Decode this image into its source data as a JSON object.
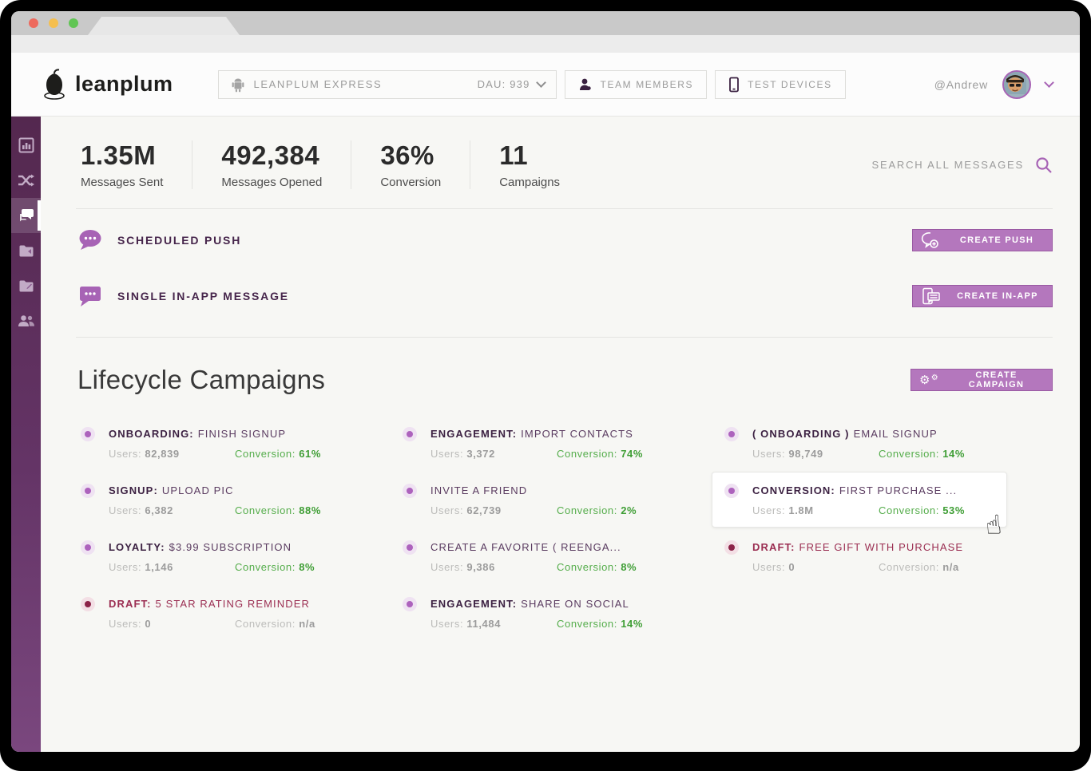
{
  "header": {
    "logo_text": "leanplum",
    "app_selector": {
      "app_name": "LEANPLUM EXPRESS",
      "dau": "DAU: 939"
    },
    "team_members_label": "TEAM MEMBERS",
    "test_devices_label": "TEST DEVICES",
    "user_handle": "@Andrew"
  },
  "sidebar": {
    "icons": [
      "bar-chart-icon",
      "shuffle-icon",
      "chat-icon",
      "folder-icon",
      "folder-icon",
      "users-icon"
    ],
    "active_index": 2
  },
  "stats": [
    {
      "value": "1.35M",
      "label": "Messages Sent"
    },
    {
      "value": "492,384",
      "label": "Messages Opened"
    },
    {
      "value": "36%",
      "label": "Conversion"
    },
    {
      "value": "11",
      "label": "Campaigns"
    }
  ],
  "search": {
    "label": "SEARCH ALL MESSAGES"
  },
  "message_types": [
    {
      "label": "SCHEDULED PUSH",
      "button_label": "CREATE PUSH"
    },
    {
      "label": "SINGLE IN-APP MESSAGE",
      "button_label": "CREATE IN-APP"
    }
  ],
  "lifecycle": {
    "title": "Lifecycle Campaigns",
    "create_button_label": "CREATE CAMPAIGN",
    "users_label": "Users:",
    "conversion_label": "Conversion:",
    "columns": [
      [
        {
          "prefix": "ONBOARDING:",
          "title": "FINISH SIGNUP",
          "users": "82,839",
          "conversion": "61%",
          "status": "active"
        },
        {
          "prefix": "SIGNUP:",
          "title": "UPLOAD PIC",
          "users": "6,382",
          "conversion": "88%",
          "status": "active"
        },
        {
          "prefix": "LOYALTY:",
          "title": "$3.99 SUBSCRIPTION",
          "users": "1,146",
          "conversion": "8%",
          "status": "active"
        },
        {
          "prefix": "DRAFT:",
          "title": "5 STAR RATING REMINDER",
          "users": "0",
          "conversion": "n/a",
          "status": "draft"
        }
      ],
      [
        {
          "prefix": "ENGAGEMENT:",
          "title": "IMPORT CONTACTS",
          "users": "3,372",
          "conversion": "74%",
          "status": "active"
        },
        {
          "prefix": "",
          "title": "INVITE A FRIEND",
          "users": "62,739",
          "conversion": "2%",
          "status": "active"
        },
        {
          "prefix": "",
          "title": "CREATE A FAVORITE ( REENGA...",
          "users": "9,386",
          "conversion": "8%",
          "status": "active"
        },
        {
          "prefix": "ENGAGEMENT:",
          "title": "SHARE ON SOCIAL",
          "users": "11,484",
          "conversion": "14%",
          "status": "active"
        }
      ],
      [
        {
          "prefix": "( ONBOARDING )",
          "title": "EMAIL SIGNUP",
          "users": "98,749",
          "conversion": "14%",
          "status": "active"
        },
        {
          "prefix": "CONVERSION:",
          "title": "FIRST PURCHASE ...",
          "users": "1.8M",
          "conversion": "53%",
          "status": "active",
          "hovered": true
        },
        {
          "prefix": "DRAFT:",
          "title": "FREE GIFT WITH PURCHASE",
          "users": "0",
          "conversion": "n/a",
          "status": "draft"
        }
      ]
    ]
  },
  "colors": {
    "accent_purple": "#a763b5",
    "button_purple": "#b477bd",
    "dark_purple_text": "#46254b",
    "draft_maroon": "#9b2e52",
    "success_green": "#55ad4b",
    "sidebar_purple": "#5e2c63"
  }
}
